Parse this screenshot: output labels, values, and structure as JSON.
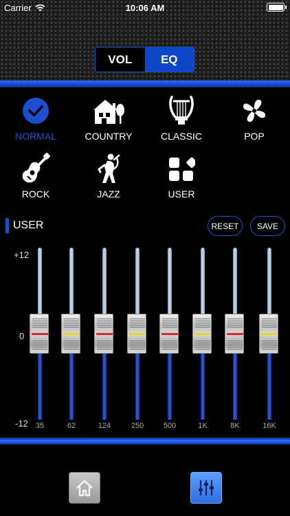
{
  "status": {
    "carrier": "Carrier",
    "time": "10:06 AM"
  },
  "tabs": {
    "vol": "VOL",
    "eq": "EQ"
  },
  "presets": [
    {
      "label": "NORMAL",
      "icon": "checkmark-circle-icon",
      "selected": true
    },
    {
      "label": "COUNTRY",
      "icon": "house-tree-icon"
    },
    {
      "label": "CLASSIC",
      "icon": "lyre-icon"
    },
    {
      "label": "POP",
      "icon": "fan-icon"
    },
    {
      "label": "ROCK",
      "icon": "guitar-icon"
    },
    {
      "label": "JAZZ",
      "icon": "saxophone-player-icon"
    },
    {
      "label": "USER",
      "icon": "grid-shapes-icon"
    }
  ],
  "eq": {
    "section_label": "USER",
    "reset_label": "RESET",
    "save_label": "SAVE",
    "axis_top": "+12",
    "axis_mid": "0",
    "axis_bottom": "-12",
    "range_db": [
      -12,
      12
    ],
    "bands": [
      {
        "freq": "35",
        "gain_db": 0,
        "center_color": "#e0262a"
      },
      {
        "freq": "62",
        "gain_db": 0,
        "center_color": "#e8d820"
      },
      {
        "freq": "124",
        "gain_db": 0,
        "center_color": "#e0262a"
      },
      {
        "freq": "250",
        "gain_db": 0,
        "center_color": "#e8d820"
      },
      {
        "freq": "500",
        "gain_db": 0,
        "center_color": "#e0262a"
      },
      {
        "freq": "1K",
        "gain_db": 0,
        "center_color": "#e8d820"
      },
      {
        "freq": "8K",
        "gain_db": 0,
        "center_color": "#e0262a"
      },
      {
        "freq": "16K",
        "gain_db": 0,
        "center_color": "#e8d820"
      }
    ]
  },
  "bottom_nav": [
    {
      "icon": "home-icon",
      "active": false
    },
    {
      "icon": "equalizer-sliders-icon",
      "active": true
    }
  ],
  "colors": {
    "accent": "#1451c7",
    "selected_text": "#1c4fd0"
  }
}
